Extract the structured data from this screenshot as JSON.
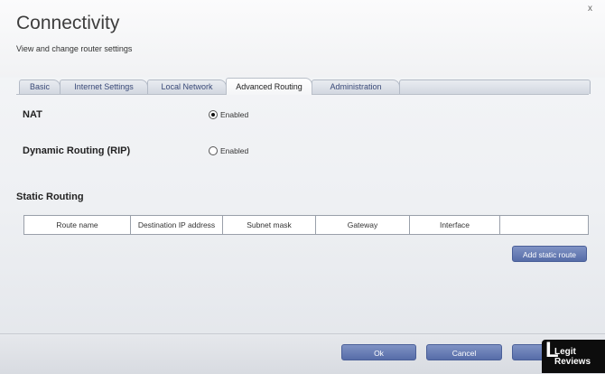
{
  "header": {
    "title": "Connectivity",
    "subtitle": "View and change router settings",
    "close_glyph": "x"
  },
  "tabs": [
    {
      "label": "Basic",
      "active": false
    },
    {
      "label": "Internet Settings",
      "active": false
    },
    {
      "label": "Local Network",
      "active": false
    },
    {
      "label": "Advanced Routing",
      "active": true
    },
    {
      "label": "Administration",
      "active": false
    }
  ],
  "settings": {
    "nat": {
      "label": "NAT",
      "option": "Enabled",
      "checked": true
    },
    "rip": {
      "label": "Dynamic Routing (RIP)",
      "option": "Enabled",
      "checked": false
    }
  },
  "static_routing": {
    "title": "Static Routing",
    "columns": [
      "Route name",
      "Destination IP address",
      "Subnet mask",
      "Gateway",
      "Interface",
      ""
    ],
    "add_button": "Add static route"
  },
  "footer": {
    "ok": "Ok",
    "cancel": "Cancel",
    "third": ""
  },
  "watermark": {
    "letter": "L",
    "line1": "Legit",
    "line2": "Reviews"
  },
  "colors": {
    "button": "#566ca8",
    "tab_text": "#3a4a78",
    "background": "#eef0f3"
  }
}
